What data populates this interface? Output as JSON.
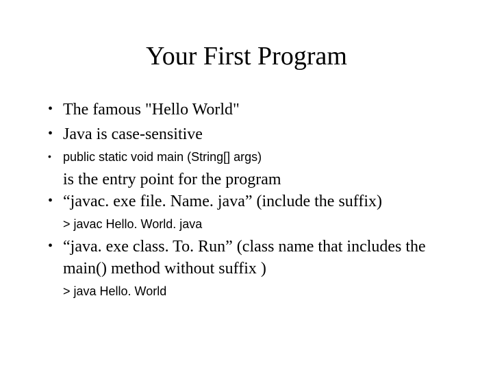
{
  "title": "Your First Program",
  "bullets": {
    "b1": "The famous \"Hello World\"",
    "b2": "Java is case-sensitive",
    "b3_code": "public static void main (String[] args)",
    "b3_cont": "is the entry point for the program",
    "b4": "“javac. exe file. Name. java” (include the suffix)",
    "b4_sub": "> javac Hello. World. java",
    "b5": "“java. exe class. To. Run” (class name that includes the main() method without suffix )",
    "b5_sub": "> java Hello. World"
  }
}
